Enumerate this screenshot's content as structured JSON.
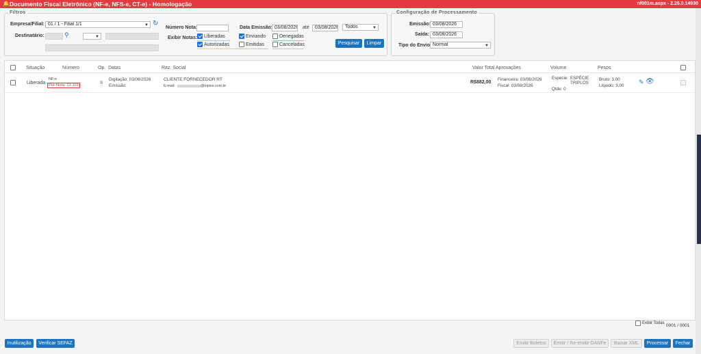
{
  "app": {
    "title": "Documento Fiscal Eletrônico (NF-e, NFS-e, CT-e) - Homologação",
    "version": "nf001m.aspx - 2.26.0.14930"
  },
  "filtros": {
    "legend": "Filtros",
    "empresa_label": "Empresa/Filial:",
    "empresa_value": "01 / 1 - Filial 1/1",
    "destinatario_label": "Destinatário:",
    "numero_nota_label": "Número Nota:",
    "data_emissao_label": "Data Emissão:",
    "data_inicio": "03/08/2026",
    "ate_label": "até",
    "data_fim": "03/08/2026",
    "todos_value": "Todos",
    "exibir_label": "Exibir Notas:",
    "opts": {
      "liberadas": "Liberadas",
      "enviando": "Enviando",
      "denegadas": "Denegadas",
      "autorizadas": "Autorizadas",
      "emitidas": "Emitidas",
      "canceladas": "Canceladas"
    },
    "pesquisar": "Pesquisar",
    "limpar": "Limpar"
  },
  "config": {
    "legend": "Configuração de Processamento",
    "emissao_label": "Emissão:",
    "emissao_value": "03/08/2026",
    "saida_label": "Saída:",
    "saida_value": "03/08/2026",
    "tipo_label": "Tipo do Envio:",
    "tipo_value": "Normal"
  },
  "table": {
    "headers": {
      "situacao": "Situação",
      "numero": "Número",
      "op": "Op.",
      "datas": "Datas",
      "raz": "Raz. Social",
      "valor": "Valor Total",
      "aprov": "Aprovações",
      "volume": "Volume",
      "pesos": "Pesos"
    },
    "row": {
      "situacao": "Liberada",
      "tipo": "NF-e",
      "pre_nota": "Pré-Nota: 12.119",
      "op": "S",
      "digitacao": "Digitação: 03/08/2026",
      "emissao": "Emissão:",
      "razao": "CLIENTE FORNECEDOR RT",
      "email_label": "E-mail:",
      "email_domain": "@triplos.com.br",
      "valor": "R$882,00",
      "financeira": "Financeira: 03/08/2026",
      "fiscal": "Fiscal: 03/08/2026",
      "especie_label": "Espécie:",
      "especie_value": "ESPÉCIE",
      "especie_value2": "TRIPLOS",
      "qtde": "Qtde: 0",
      "bruto": "Bruto: 3,00",
      "liquido": "Líquido: 3,00"
    },
    "exibir_todas": "Exibir Todas",
    "pager": "0001 / 0001"
  },
  "footer": {
    "inutilizacao": "Inutilização",
    "verificar": "Verificar SEFAZ",
    "emitir_boletos": "Emitir Boletos",
    "emitir_danfe": "Emitir / Re-emitir DANFe",
    "baixar_xml": "Baixar XML",
    "processar": "Processar",
    "fechar": "Fechar"
  },
  "colors": {
    "title_bar": "#e53a40",
    "primary_button": "#1e73be",
    "checkbox_on": "#1a73e8",
    "pre_nota_red": "#d9363e"
  }
}
